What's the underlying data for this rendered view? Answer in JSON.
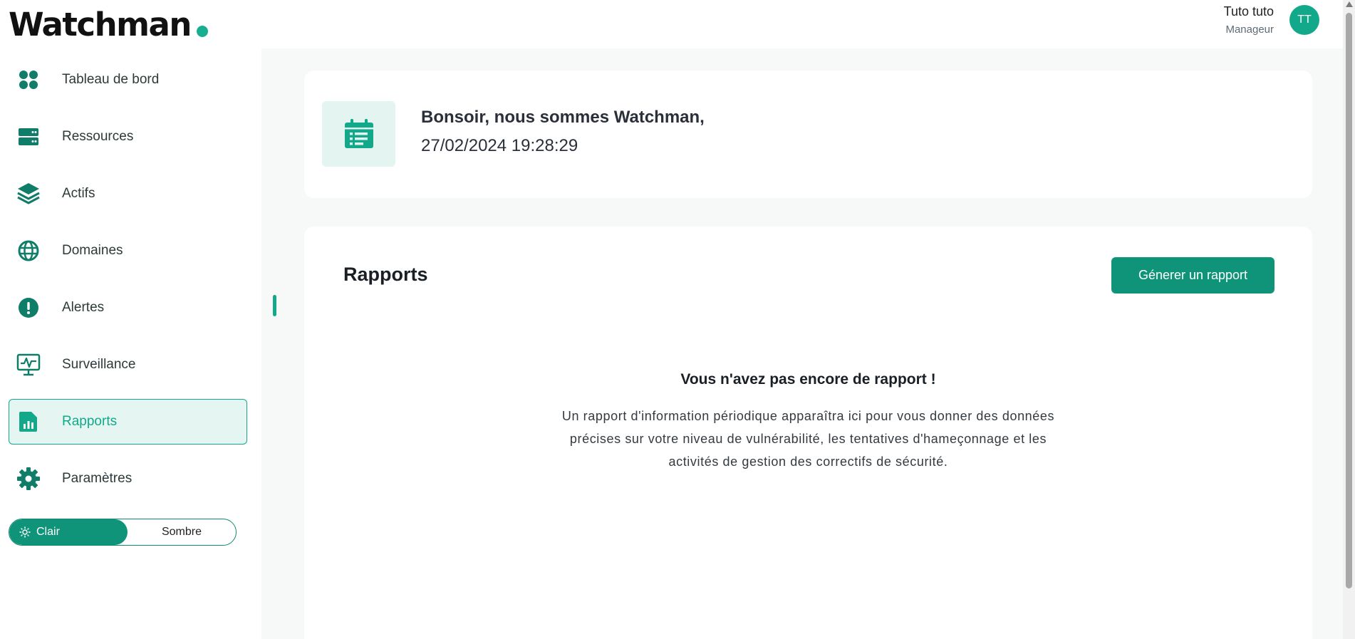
{
  "brand": {
    "name": "Watchman",
    "accent": "#11a98a"
  },
  "user": {
    "name": "Tuto tuto",
    "role": "Manageur",
    "initials": "TT"
  },
  "sidebar": {
    "items": [
      {
        "label": "Tableau de bord",
        "icon": "dashboard-grid-icon",
        "active": false
      },
      {
        "label": "Ressources",
        "icon": "server-icon",
        "active": false
      },
      {
        "label": "Actifs",
        "icon": "layers-icon",
        "active": false
      },
      {
        "label": "Domaines",
        "icon": "globe-icon",
        "active": false
      },
      {
        "label": "Alertes",
        "icon": "alert-icon",
        "active": false
      },
      {
        "label": "Surveillance",
        "icon": "monitor-pulse-icon",
        "active": false
      },
      {
        "label": "Rapports",
        "icon": "report-file-icon",
        "active": true
      },
      {
        "label": "Paramètres",
        "icon": "gear-icon",
        "active": false
      }
    ]
  },
  "theme": {
    "light_label": "Clair",
    "dark_label": "Sombre",
    "selected": "light"
  },
  "welcome": {
    "greeting": "Bonsoir, nous sommes Watchman,",
    "datetime": "27/02/2024 19:28:29"
  },
  "reports": {
    "title": "Rapports",
    "generate_label": "Génerer un rapport",
    "empty_title": "Vous n'avez pas encore de rapport !",
    "empty_description": "Un rapport d'information périodique apparaîtra ici pour vous donner des données précises sur votre niveau de vulnérabilité, les tentatives d'hameçonnage et les activités de gestion des correctifs de sécurité."
  }
}
